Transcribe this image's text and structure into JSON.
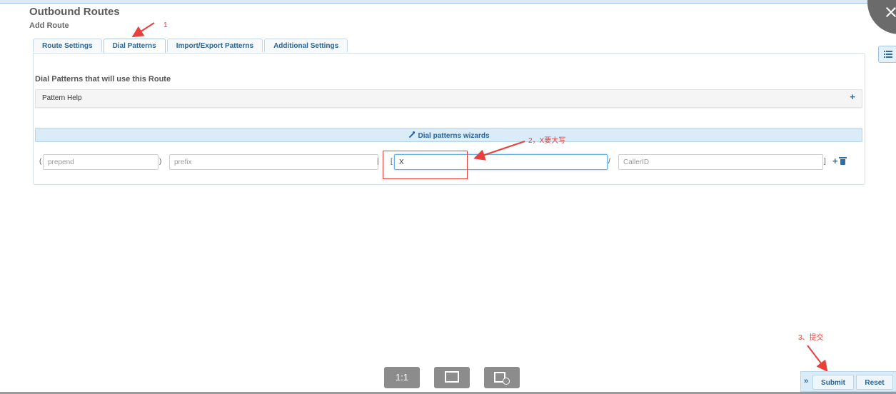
{
  "header": {
    "title": "Outbound Routes",
    "subtitle": "Add Route"
  },
  "tabs": [
    {
      "label": "Route Settings",
      "active": false
    },
    {
      "label": "Dial Patterns",
      "active": true
    },
    {
      "label": "Import/Export Patterns",
      "active": false
    },
    {
      "label": "Additional Settings",
      "active": false
    }
  ],
  "section": {
    "heading": "Dial Patterns that will use this Route",
    "help_label": "Pattern Help",
    "help_toggle": "+",
    "wizard_label": "Dial patterns wizards"
  },
  "pattern_row": {
    "open_paren": "(",
    "close_paren": ")",
    "pipe": "|",
    "open_bracket": "[",
    "slash": "/",
    "close_bracket": "]",
    "prepend": {
      "placeholder": "prepend",
      "value": ""
    },
    "prefix": {
      "placeholder": "prefix",
      "value": ""
    },
    "match": {
      "placeholder": "",
      "value": "X"
    },
    "callerid": {
      "placeholder": "CallerID",
      "value": ""
    },
    "add_glyph": "+"
  },
  "annotations": {
    "a1": "1",
    "a2": "2，X要大写",
    "a3": "3、提交"
  },
  "actions": {
    "toggle_glyph": "»",
    "submit": "Submit",
    "reset": "Reset"
  },
  "viewer": {
    "one_to_one": "1:1"
  },
  "colors": {
    "accent": "#2a6496",
    "annotation_red": "#e8403b",
    "wizard_bg": "#d9ecf8"
  },
  "icons": [
    "close-icon",
    "list-icon",
    "plus-icon",
    "trash-icon",
    "wand-icon",
    "fit-screen-icon",
    "crop-icon",
    "chevron-double-right-icon"
  ]
}
